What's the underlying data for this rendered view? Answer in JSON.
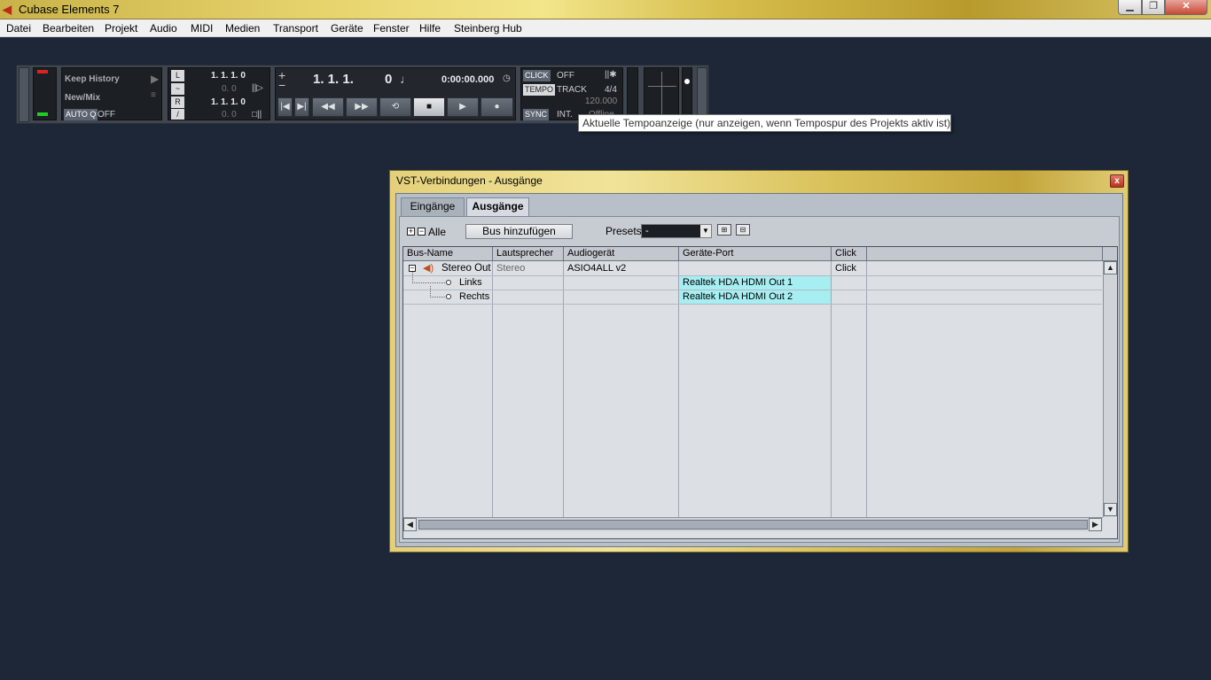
{
  "window": {
    "title": "Cubase Elements 7",
    "icon": "cubase-logo-icon",
    "minimize": "▁",
    "maximize": "❐",
    "close": "✕"
  },
  "menu": [
    "Datei",
    "Bearbeiten",
    "Projekt",
    "Audio",
    "MIDI",
    "Medien",
    "Transport",
    "Geräte",
    "Fenster",
    "Hilfe",
    "Steinberg Hub"
  ],
  "transport": {
    "keep_history": "Keep History",
    "new_mix": "New/Mix",
    "auto_q": "AUTO Q",
    "auto_q_value": "OFF",
    "left_locator": "1. 1. 1.  0",
    "left_locator_sub": "0.  0",
    "right_locator": "1. 1. 1.  0",
    "right_locator_sub": "0.  0",
    "position_bars": "1. 1. 1.",
    "position_ticks": "0",
    "position_time": "0:00:00.000",
    "click_label": "CLICK",
    "click_value": "OFF",
    "tempo_label": "TEMPO",
    "tempo_mode": "TRACK",
    "signature": "4/4",
    "tempo_value": "120.000",
    "sync_label": "SYNC",
    "sync_value": "INT.",
    "offline": "Offline",
    "plus": "+",
    "minus": "−"
  },
  "tooltip": "Aktuelle Tempoanzeige (nur anzeigen, wenn Tempospur des Projekts aktiv ist)",
  "dialog": {
    "title": "VST-Verbindungen - Ausgänge",
    "close": "x",
    "tabs": [
      "Eingänge",
      "Ausgänge"
    ],
    "active_tab": "Ausgänge",
    "expand_all": "+",
    "collapse_all": "−",
    "all_label": "Alle",
    "add_bus": "Bus hinzufügen",
    "presets_label": "Presets",
    "presets_value": "-",
    "columns": [
      "Bus-Name",
      "Lautsprecher",
      "Audiogerät",
      "Geräte-Port",
      "Click"
    ],
    "rows": [
      {
        "bus": "Stereo Out",
        "speaker": "Stereo",
        "device": "ASIO4ALL v2",
        "port": "",
        "click": "Click"
      },
      {
        "bus": "Links",
        "speaker": "",
        "device": "",
        "port": "Realtek HDA HDMI Out 1",
        "click": ""
      },
      {
        "bus": "Rechts",
        "speaker": "",
        "device": "",
        "port": "Realtek HDA HDMI Out 2",
        "click": ""
      }
    ]
  },
  "colors": {
    "background": "#1d2738",
    "port_highlight": "#a6eef2"
  }
}
